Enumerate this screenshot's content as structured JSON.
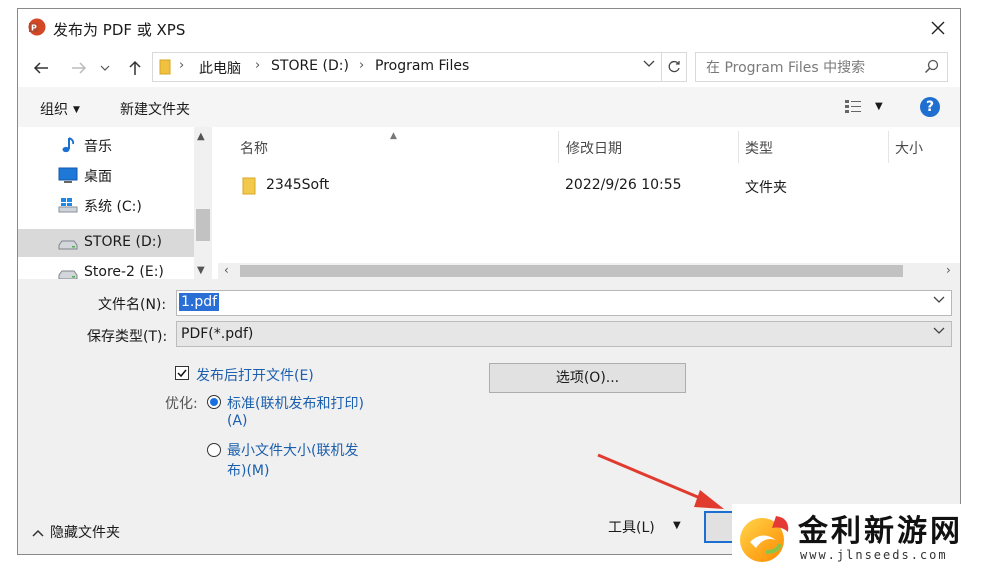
{
  "window": {
    "title": "发布为 PDF 或 XPS"
  },
  "address": {
    "crumbs": [
      "此电脑",
      "STORE (D:)",
      "Program Files"
    ],
    "separator": "›"
  },
  "search": {
    "placeholder": "在 Program Files 中搜索"
  },
  "toolbar": {
    "organize": "组织",
    "new_folder": "新建文件夹"
  },
  "help": {
    "label": "?"
  },
  "nav_pane": {
    "items": [
      {
        "label": "音乐",
        "icon": "music-note-icon",
        "selected": false
      },
      {
        "label": "桌面",
        "icon": "desktop-icon",
        "selected": false
      },
      {
        "label": "系统 (C:)",
        "icon": "windows-drive-icon",
        "selected": false
      },
      {
        "label": "STORE (D:)",
        "icon": "drive-icon",
        "selected": true
      },
      {
        "label": "Store-2 (E:)",
        "icon": "drive-icon",
        "selected": false
      }
    ]
  },
  "file_list": {
    "columns": [
      "名称",
      "修改日期",
      "类型",
      "大小"
    ],
    "rows": [
      {
        "name": "2345Soft",
        "modified": "2022/9/26 10:55",
        "type": "文件夹"
      }
    ]
  },
  "form": {
    "filename_label": "文件名(N):",
    "filename_value": "1.pdf",
    "filetype_label": "保存类型(T):",
    "filetype_value": "PDF(*.pdf)",
    "open_after_label": "发布后打开文件(E)",
    "open_after_checked": true,
    "optimize_label": "优化:",
    "option_standard_line1": "标准(联机发布和打印)",
    "option_standard_line2": "(A)",
    "option_min_line1": "最小文件大小(联机发",
    "option_min_line2": "布)(M)",
    "options_button": "选项(O)...",
    "tools_label": "工具(L)",
    "hide_folders": "隐藏文件夹"
  },
  "watermark": {
    "name": "金利新游网",
    "url": "www.jlnseeds.com"
  },
  "colors": {
    "accent": "#1a6fd0",
    "selection": "#2a6fd6",
    "arrow": "#e03b2e"
  }
}
